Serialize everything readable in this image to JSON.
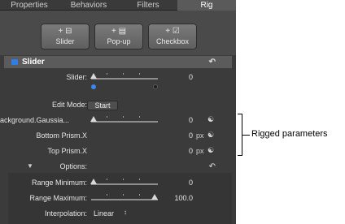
{
  "tabs": [
    "Properties",
    "Behaviors",
    "Filters",
    "Rig"
  ],
  "buttons": [
    {
      "icon": "+ ⊟",
      "label": "Slider"
    },
    {
      "icon": "+ ▤",
      "label": "Pop-up"
    },
    {
      "icon": "+ ☑",
      "label": "Checkbox"
    }
  ],
  "section": {
    "title": "Slider",
    "reset": "↶"
  },
  "slider": {
    "label": "Slider:",
    "value": "0"
  },
  "edit_mode": {
    "label": "Edit Mode:",
    "button": "Start"
  },
  "params": [
    {
      "label": "Background.Gaussia...",
      "value": "0",
      "unit": ""
    },
    {
      "label": "Bottom Prism.X",
      "value": "0",
      "unit": "px"
    },
    {
      "label": "Top Prism.X",
      "value": "0",
      "unit": "px"
    }
  ],
  "options": {
    "label": "Options:",
    "triangle": "▼",
    "reset": "↶"
  },
  "range_min": {
    "label": "Range Minimum:",
    "value": "0"
  },
  "range_max": {
    "label": "Range Maximum:",
    "value": "100.0"
  },
  "interpolation": {
    "label": "Interpolation:",
    "value": "Linear",
    "arrows": "↕"
  },
  "callout": "Rigged parameters",
  "colors": {
    "accent": "#2f7ee6",
    "panel": "#3b3b3b",
    "header": "#5b5b5b"
  }
}
